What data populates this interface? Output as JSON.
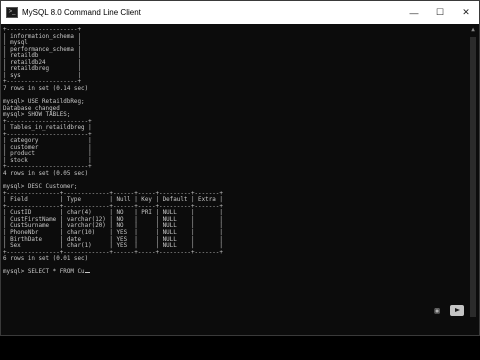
{
  "window": {
    "title": "MySQL 8.0 Command Line Client",
    "minimize_icon": "minimize-icon",
    "maximize_icon": "maximize-icon",
    "close_icon": "close-icon"
  },
  "terminal_lines": [
    "+--------------------+",
    "| information_schema |",
    "| mysql              |",
    "| performance_schema |",
    "| retaildb           |",
    "| retaildb24         |",
    "| retaildbreg        |",
    "| sys                |",
    "+--------------------+",
    "7 rows in set (0.14 sec)",
    "",
    "mysql> USE RetaildbReg;",
    "Database changed",
    "mysql> SHOW TABLES;",
    "+-----------------------+",
    "| Tables_in_retaildbreg |",
    "+-----------------------+",
    "| category              |",
    "| customer              |",
    "| product               |",
    "| stock                 |",
    "+-----------------------+",
    "4 rows in set (0.05 sec)",
    "",
    "mysql> DESC Customer;",
    "+---------------+-------------+------+-----+---------+-------+",
    "| Field         | Type        | Null | Key | Default | Extra |",
    "+---------------+-------------+------+-----+---------+-------+",
    "| CustID        | char(4)     | NO   | PRI | NULL    |       |",
    "| CustFirstName | varchar(12) | NO   |     | NULL    |       |",
    "| CustSurname   | varchar(20) | NO   |     | NULL    |       |",
    "| PhoneNbr      | char(10)    | YES  |     | NULL    |       |",
    "| BirthDate     | date        | YES  |     | NULL    |       |",
    "| Sex           | char(1)     | YES  |     | NULL    |       |",
    "+---------------+-------------+------+-----+---------+-------+",
    "6 rows in set (0.01 sec)",
    "",
    "mysql> SELECT * FROM Cu"
  ]
}
